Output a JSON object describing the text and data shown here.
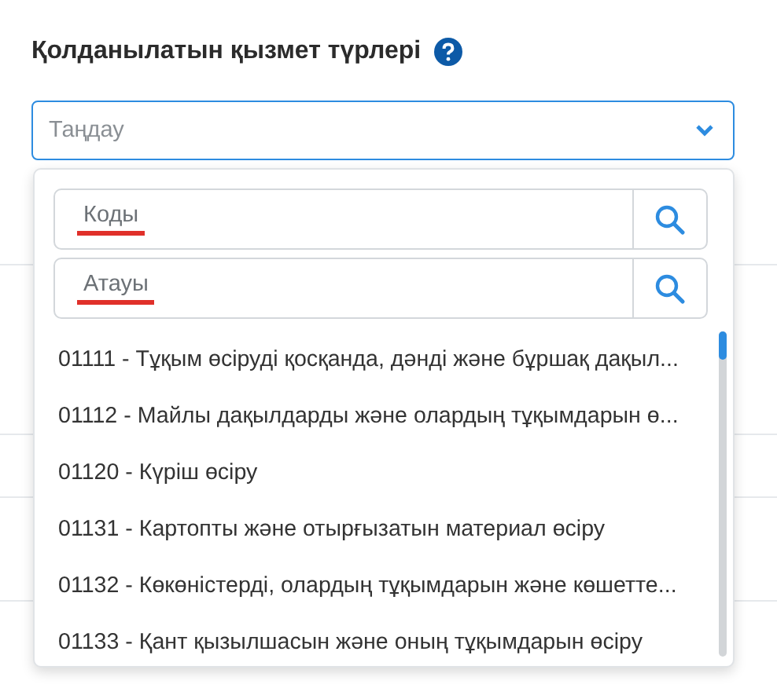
{
  "label": "Қолданылатын қызмет түрлері",
  "help_icon": true,
  "select": {
    "placeholder": "Таңдау",
    "expanded": true
  },
  "search_fields": [
    {
      "placeholder": "Коды",
      "underlined": true
    },
    {
      "placeholder": "Атауы",
      "underlined": true
    }
  ],
  "options": [
    "01111 - Тұқым өсіруді қосқанда, дәнді және бұршақ дақыл...",
    "01112 - Майлы дақылдарды және олардың тұқымдарын ө...",
    "01120 - Күріш өсіру",
    "01131 - Картопты және отырғызатын материал өсіру",
    "01132 - Көкөністерді, олардың тұқымдарын және көшетте...",
    "01133 - Қант қызылшасын және оның тұқымдарын өсіру"
  ]
}
